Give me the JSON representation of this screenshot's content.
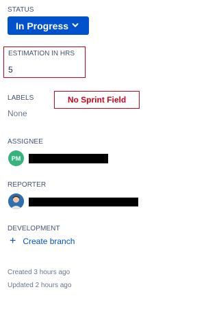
{
  "status": {
    "label": "STATUS",
    "value": "In Progress"
  },
  "estimation": {
    "label": "ESTIMATION IN HRS",
    "value": "5"
  },
  "labels": {
    "label": "LABELS",
    "value": "None"
  },
  "annotation": {
    "text": "No Sprint Field",
    "color": "#d0021b"
  },
  "assignee": {
    "label": "ASSIGNEE",
    "initials": "PM",
    "avatar_color": "#36b37e"
  },
  "reporter": {
    "label": "REPORTER"
  },
  "development": {
    "label": "DEVELOPMENT",
    "create_branch": "Create branch"
  },
  "meta": {
    "created": "Created 3 hours ago",
    "updated": "Updated 2 hours ago"
  },
  "colors": {
    "primary": "#0052cc",
    "text": "#172b4d",
    "muted": "#6b778c"
  },
  "icons": {
    "status_dropdown": "chevron-down-icon",
    "create_branch": "plus-icon"
  }
}
